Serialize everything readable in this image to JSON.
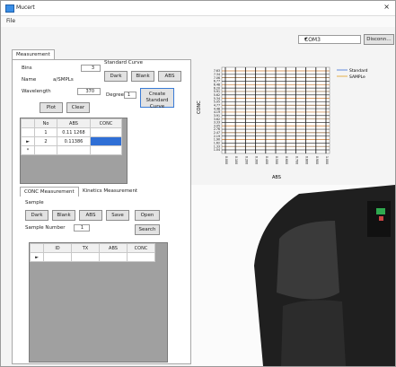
{
  "window": {
    "title": "Mucert",
    "close": "×"
  },
  "menu": {
    "file": "File"
  },
  "port_combo": {
    "value": "COM3"
  },
  "disconnect_label": "Disconn…",
  "tabs": {
    "main": "Measurement"
  },
  "settings": {
    "bins_label": "Bins",
    "bins_value": "3",
    "name_label": "Name",
    "name_value": "a/SMPLs",
    "wavelength_label": "Wavelength",
    "wavelength_value": "370"
  },
  "buttons": {
    "plot": "Plot",
    "clear": "Clear",
    "dark": "Dark",
    "blank": "Blank",
    "abs": "ABS",
    "create": "Create Standard Curve"
  },
  "standard_curve": {
    "label": "Standard Curve",
    "degree_label": "Degree",
    "degree_value": "1"
  },
  "table1": {
    "headers": [
      "",
      "No",
      "ABS",
      "CONC"
    ],
    "rows": [
      [
        "",
        "1",
        "0.11 1268",
        ""
      ],
      [
        "►",
        "2",
        "0.11386",
        ""
      ],
      [
        "*",
        "",
        "",
        ""
      ]
    ]
  },
  "sub_tabs": {
    "conc": "CONC Measurement",
    "kinetics": "Kinetics Measurement"
  },
  "sample": {
    "group_label": "Sample",
    "number_label": "Sample Number",
    "number_value": "1"
  },
  "sample_buttons": {
    "dark": "Dark",
    "blank": "Blank",
    "abs": "ABS",
    "save": "Save",
    "open": "Open",
    "search": "Search"
  },
  "table2": {
    "headers": [
      "",
      "ID",
      "TX",
      "ABS",
      "CONC"
    ],
    "rows": [
      [
        "►",
        "",
        "",
        "",
        ""
      ]
    ]
  },
  "chart_data": {
    "type": "line",
    "ylabel": "CONC",
    "xlabel": "ABS",
    "series": [
      {
        "name": "Standard",
        "color": "#3a6fd6"
      },
      {
        "name": "SAMPLe",
        "color": "#e0a020"
      }
    ],
    "yticks": [
      "7.63",
      "7.34",
      "7.06",
      "6.77",
      "6.48",
      "6.20",
      "5.91",
      "5.62",
      "5.34",
      "5.05",
      "4.77",
      "4.48",
      "4.19",
      "3.91",
      "3.62",
      "3.33",
      "3.05",
      "2.76",
      "2.47",
      "2.19",
      "1.90",
      "1.62",
      "1.33",
      "1.04"
    ],
    "xticks": [
      "0.000",
      "0.100",
      "0.200",
      "0.300",
      "0.400",
      "0.500",
      "0.600",
      "0.700",
      "0.800",
      "0.900",
      "1.000"
    ]
  }
}
